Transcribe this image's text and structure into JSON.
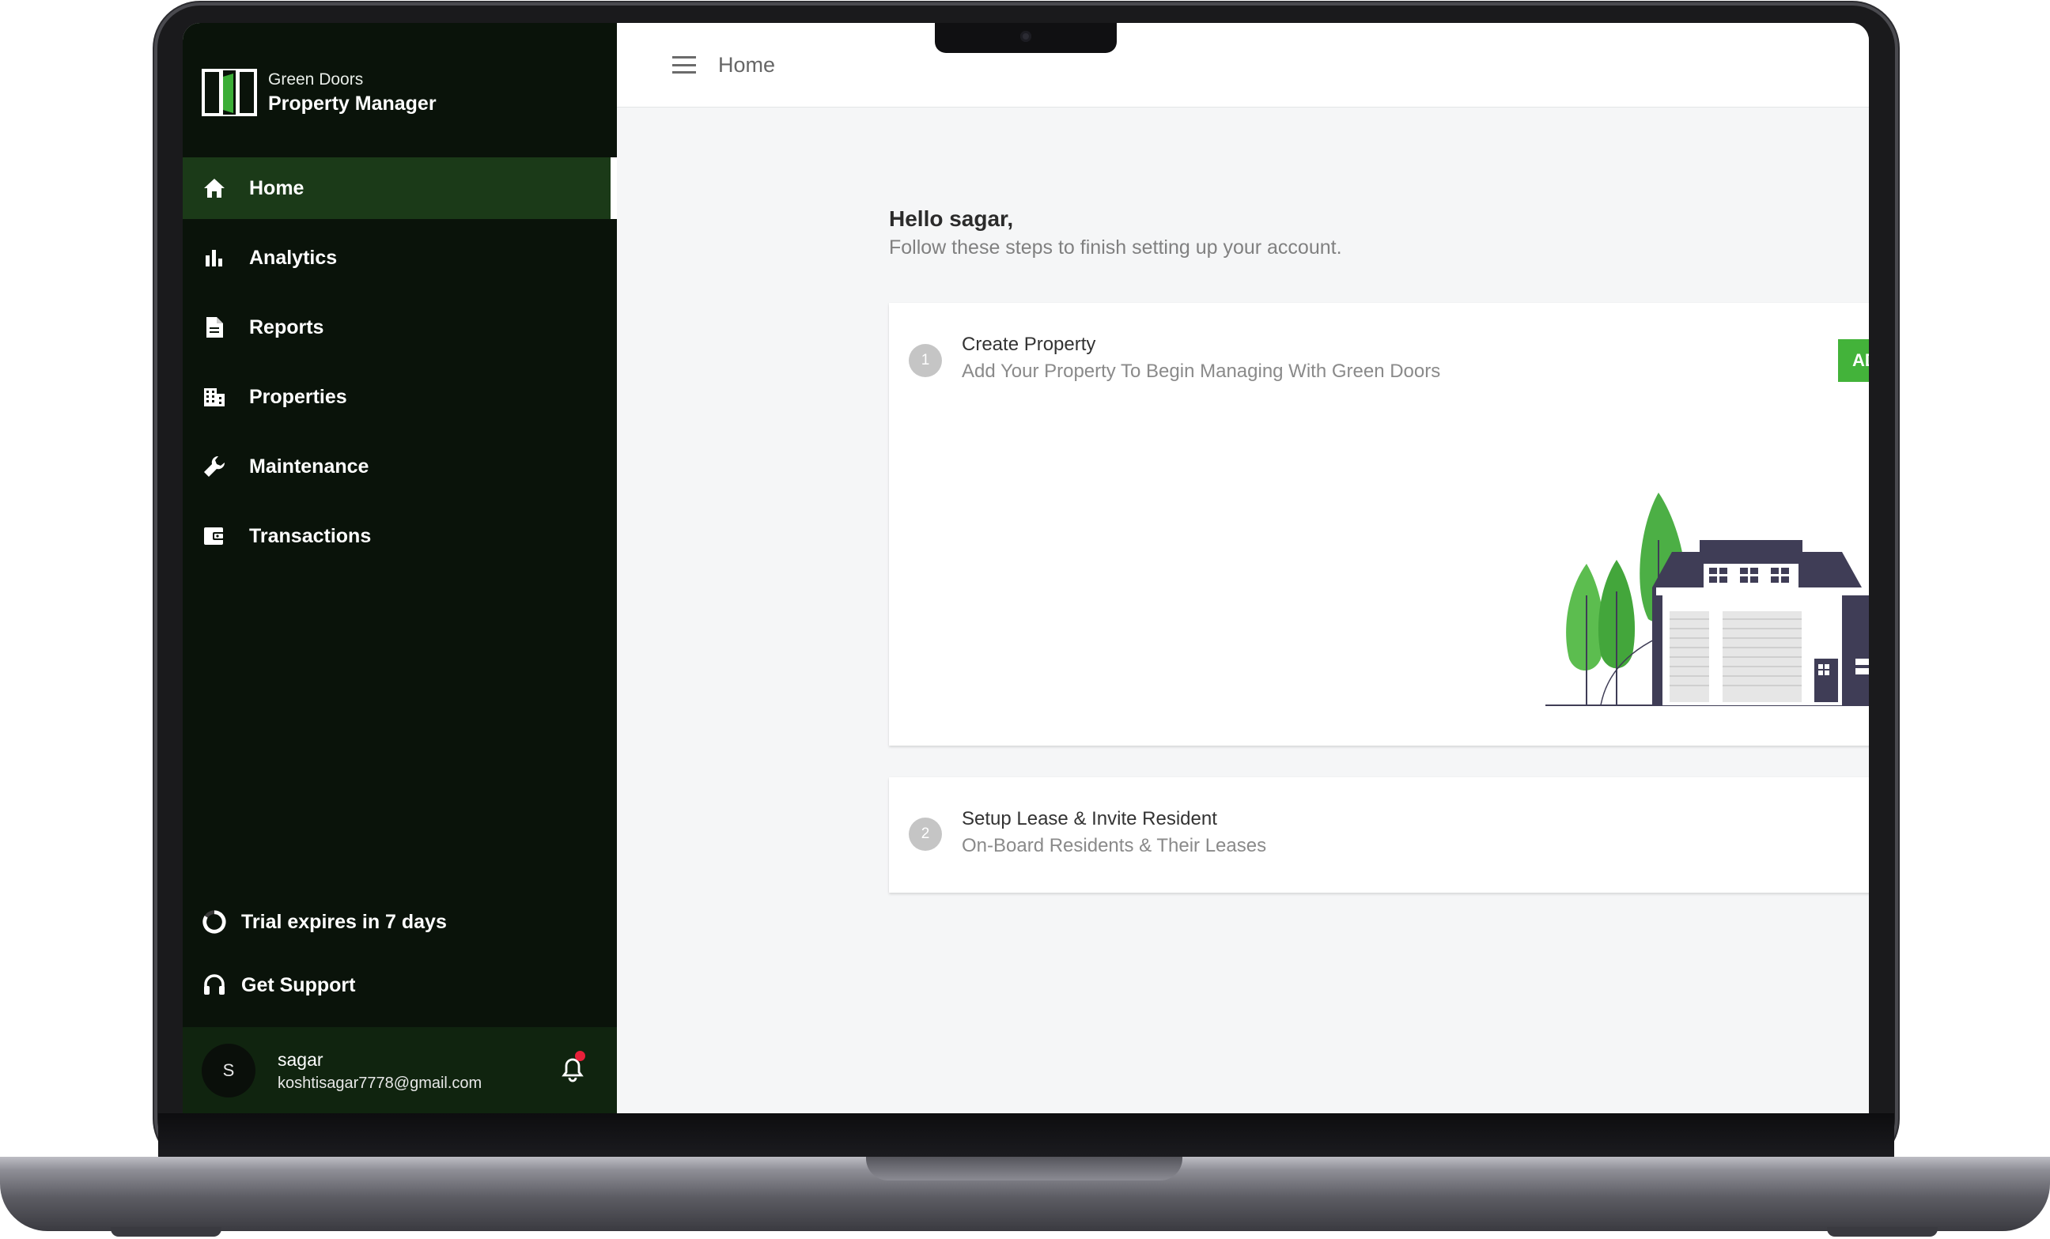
{
  "brand": {
    "line1": "Green Doors",
    "line2": "Property Manager"
  },
  "nav": [
    {
      "label": "Home",
      "icon": "home-icon",
      "active": true
    },
    {
      "label": "Analytics",
      "icon": "bar-chart-icon",
      "active": false
    },
    {
      "label": "Reports",
      "icon": "document-icon",
      "active": false
    },
    {
      "label": "Properties",
      "icon": "building-icon",
      "active": false
    },
    {
      "label": "Maintenance",
      "icon": "wrench-icon",
      "active": false
    },
    {
      "label": "Transactions",
      "icon": "wallet-icon",
      "active": false
    }
  ],
  "sidebar_bottom": {
    "trial": "Trial expires in 7 days",
    "support": "Get Support"
  },
  "user": {
    "initial": "S",
    "name": "sagar",
    "email": "koshtisagar7778@gmail.com",
    "has_notification": true
  },
  "topbar": {
    "title": "Home"
  },
  "greeting": {
    "hello": "Hello sagar,",
    "subtitle": "Follow these steps to finish setting up your account."
  },
  "steps": [
    {
      "number": "1",
      "title": "Create Property",
      "subtitle": "Add Your Property To Begin Managing With Green Doors",
      "button": "AD"
    },
    {
      "number": "2",
      "title": "Setup Lease & Invite Resident",
      "subtitle": "On-Board Residents & Their Leases"
    }
  ],
  "colors": {
    "sidebar_bg": "#0a130a",
    "active_item_bg": "#1b3a18",
    "accent_green": "#43b33a",
    "notification_dot": "#e8203a"
  }
}
